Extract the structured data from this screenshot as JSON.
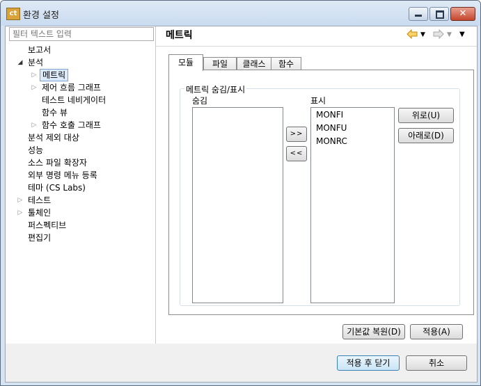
{
  "window": {
    "icon_text": "ct",
    "title": "환경 설정"
  },
  "filter": {
    "placeholder": "필터 텍스트 입력"
  },
  "tree": [
    {
      "label": "보고서",
      "level": 0,
      "arrow": "none"
    },
    {
      "label": "분석",
      "level": 0,
      "arrow": "expanded"
    },
    {
      "label": "메트릭",
      "level": 1,
      "arrow": "collapsed",
      "selected": true
    },
    {
      "label": "제어 흐름 그래프",
      "level": 1,
      "arrow": "collapsed"
    },
    {
      "label": "테스트 네비게이터",
      "level": 1,
      "arrow": "none"
    },
    {
      "label": "함수 뷰",
      "level": 1,
      "arrow": "none"
    },
    {
      "label": "함수 호출 그래프",
      "level": 1,
      "arrow": "collapsed"
    },
    {
      "label": "분석 제외 대상",
      "level": 0,
      "arrow": "none"
    },
    {
      "label": "성능",
      "level": 0,
      "arrow": "none"
    },
    {
      "label": "소스 파일 확장자",
      "level": 0,
      "arrow": "none"
    },
    {
      "label": "외부 명령 메뉴 등록",
      "level": 0,
      "arrow": "none"
    },
    {
      "label": "테마 (CS Labs)",
      "level": 0,
      "arrow": "none"
    },
    {
      "label": "테스트",
      "level": 0,
      "arrow": "collapsed"
    },
    {
      "label": "툴체인",
      "level": 0,
      "arrow": "collapsed"
    },
    {
      "label": "퍼스펙티브",
      "level": 0,
      "arrow": "none"
    },
    {
      "label": "편집기",
      "level": 0,
      "arrow": "none"
    }
  ],
  "page": {
    "title": "메트릭"
  },
  "tabs": [
    {
      "label": "모듈",
      "active": true
    },
    {
      "label": "파일",
      "active": false
    },
    {
      "label": "클래스",
      "active": false
    },
    {
      "label": "함수",
      "active": false
    }
  ],
  "group": {
    "legend": "메트릭 숨김/표시",
    "hidden_label": "숨김",
    "shown_label": "표시",
    "hidden_items": [],
    "shown_items": [
      "MONFI",
      "MONFU",
      "MONRC"
    ],
    "move_right": ">>",
    "move_left": "<<",
    "up": "위로(U)",
    "down": "아래로(D)"
  },
  "actions": {
    "restore_defaults": "기본값 복원(D)",
    "apply": "적용(A)",
    "apply_close": "적용 후 닫기",
    "cancel": "취소"
  },
  "icons": {
    "back": "back-arrow-icon",
    "forward": "forward-arrow-icon",
    "menu": "view-menu-icon"
  },
  "colors": {
    "back_arrow": "#e6a817",
    "forward_arrow": "#c0c0c0",
    "selection_fill": "#dcebfc"
  }
}
